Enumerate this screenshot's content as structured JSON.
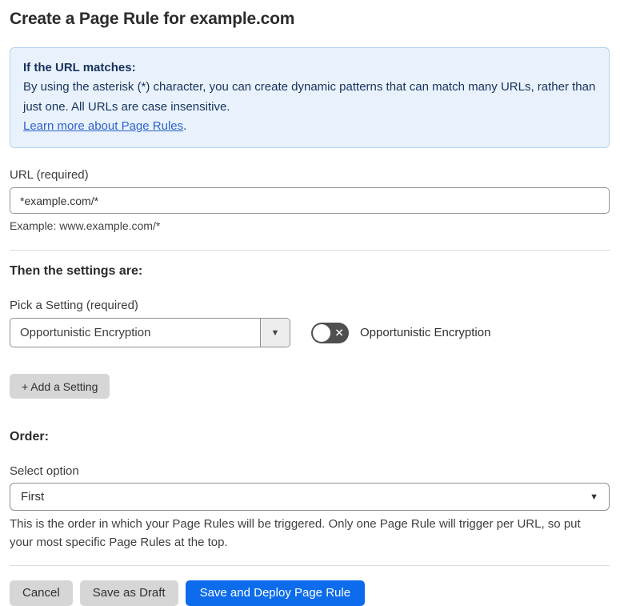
{
  "page": {
    "title": "Create a Page Rule for example.com"
  },
  "info_box": {
    "heading": "If the URL matches:",
    "body": "By using the asterisk (*) character, you can create dynamic patterns that can match many URLs, rather than just one. All URLs are case insensitive.",
    "link_label": "Learn more about Page Rules",
    "link_suffix": ".",
    "background": "#e9f2fc",
    "border_color": "#b3d1ef",
    "text_color": "#16325c"
  },
  "url_field": {
    "label": "URL (required)",
    "value": "*example.com/*",
    "helper": "Example: www.example.com/*"
  },
  "settings_section": {
    "heading": "Then the settings are:",
    "picker_label": "Pick a Setting (required)",
    "picker_value": "Opportunistic Encryption",
    "picker_caret": "▼",
    "toggle": {
      "label": "Opportunistic Encryption",
      "state": "off",
      "off_glyph": "✕"
    },
    "add_button_label": "+ Add a Setting"
  },
  "order_section": {
    "heading": "Order:",
    "select_label": "Select option",
    "select_value": "First",
    "select_caret": "▼",
    "helper": "This is the order in which your Page Rules will be triggered. Only one Page Rule will trigger per URL, so put your most specific Page Rules at the top."
  },
  "footer": {
    "cancel_label": "Cancel",
    "save_draft_label": "Save as Draft",
    "save_deploy_label": "Save and Deploy Page Rule",
    "primary_color": "#0d6ceb"
  }
}
